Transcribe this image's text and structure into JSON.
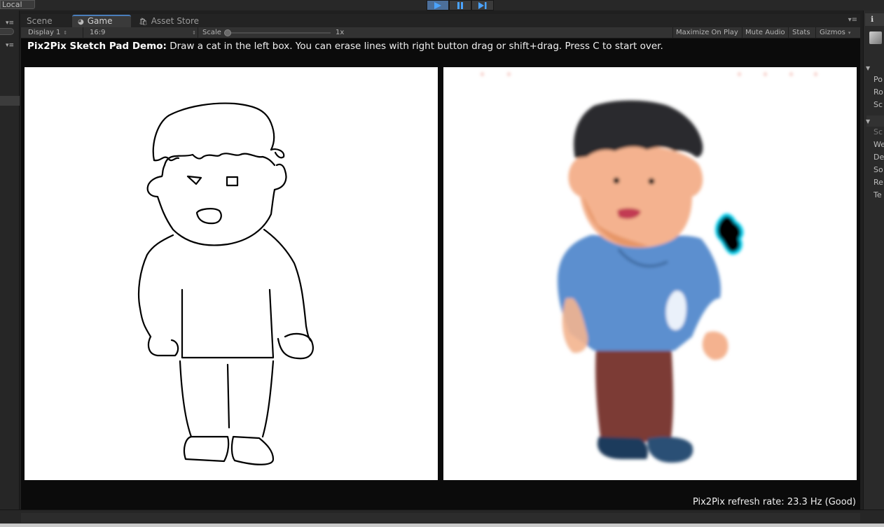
{
  "toolbar": {
    "layer_label": "Local"
  },
  "tabs": [
    {
      "label": "Scene",
      "icon": "scene-icon"
    },
    {
      "label": "Game",
      "icon": "game-icon",
      "active": true
    },
    {
      "label": "Asset Store",
      "icon": "asset-store-icon"
    }
  ],
  "game_toolbar": {
    "display": "Display 1",
    "aspect": "16:9",
    "scale_label": "Scale",
    "scale_value": "1x",
    "maximize": "Maximize On Play",
    "mute": "Mute Audio",
    "stats": "Stats",
    "gizmos": "Gizmos"
  },
  "game": {
    "title_bold": "Pix2Pix Sketch Pad Demo:",
    "instructions": " Draw a cat in the left box. You can erase lines with right button drag or shift+drag. Press C to start over.",
    "refresh_rate": "Pix2Pix refresh rate: 23.3 Hz (Good)"
  },
  "inspector": {
    "rows_a": [
      "Po",
      "Ro",
      "Sc"
    ],
    "rows_b": [
      "Sc",
      "We",
      "De",
      "So",
      "Re",
      "Te"
    ]
  },
  "colors": {
    "accent": "#4a7ebb",
    "play_active": "#4c6f9a",
    "shirt": "#5b8fcf",
    "pants": "#7b3b34",
    "skin": "#f4b28f",
    "hair": "#2a2a2e"
  }
}
